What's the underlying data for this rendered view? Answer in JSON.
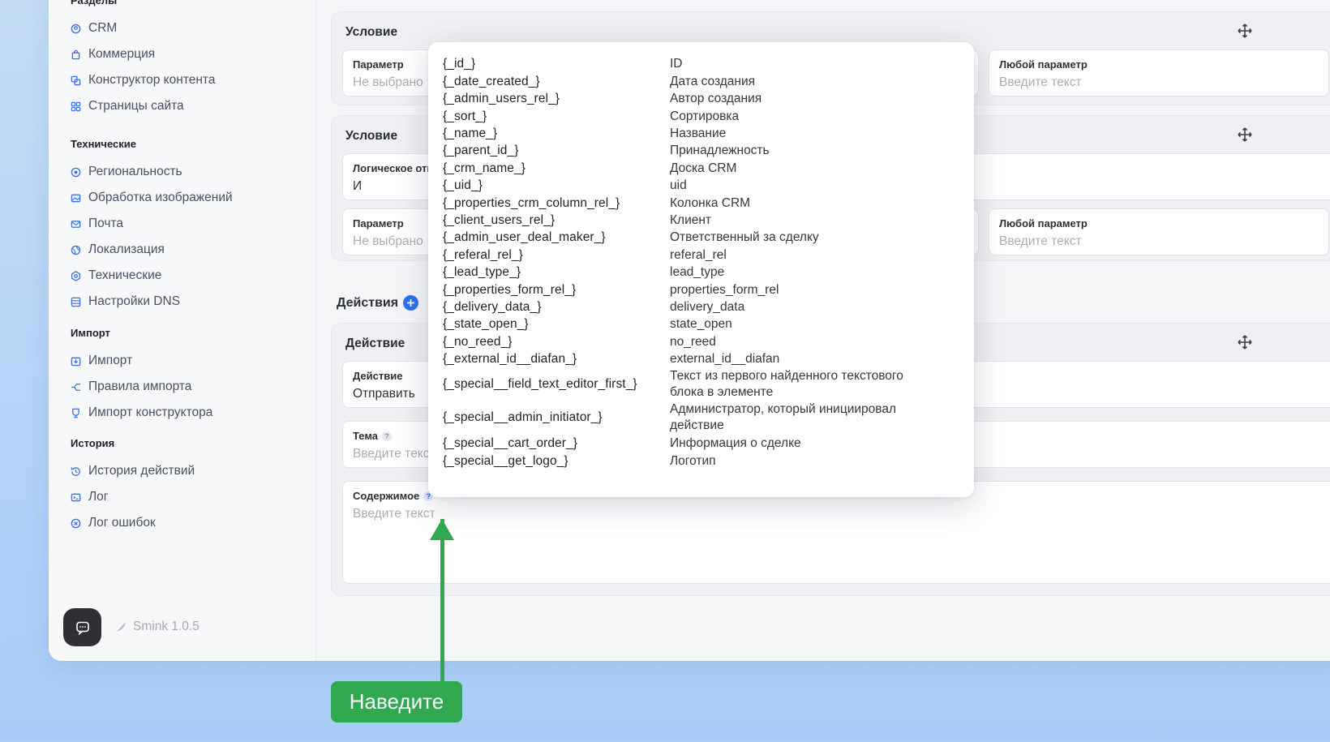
{
  "sidebar": {
    "section_title": "Разделы",
    "groups": [
      {
        "title": "",
        "items": [
          {
            "label": "CRM",
            "icon": "crm-icon"
          },
          {
            "label": "Коммерция",
            "icon": "bag-icon"
          },
          {
            "label": "Конструктор контента",
            "icon": "layers-icon"
          },
          {
            "label": "Страницы сайта",
            "icon": "grid-icon"
          }
        ]
      },
      {
        "title": "Технические",
        "items": [
          {
            "label": "Региональность",
            "icon": "location-icon"
          },
          {
            "label": "Обработка изображений",
            "icon": "image-icon"
          },
          {
            "label": "Почта",
            "icon": "mail-icon"
          },
          {
            "label": "Локализация",
            "icon": "globe-icon"
          },
          {
            "label": "Технические",
            "icon": "gear-icon"
          },
          {
            "label": "Настройки DNS",
            "icon": "server-icon"
          }
        ]
      },
      {
        "title": "Импорт",
        "items": [
          {
            "label": "Импорт",
            "icon": "import-icon"
          },
          {
            "label": "Правила импорта",
            "icon": "branch-icon"
          },
          {
            "label": "Импорт конструктора",
            "icon": "trophy-icon"
          }
        ]
      },
      {
        "title": "История",
        "items": [
          {
            "label": "История действий",
            "icon": "history-icon"
          },
          {
            "label": "Лог",
            "icon": "terminal-icon"
          },
          {
            "label": "Лог ошибок",
            "icon": "error-icon"
          }
        ]
      }
    ],
    "version": "Smink 1.0.5"
  },
  "condition1": {
    "title": "Условие",
    "param_label": "Параметр",
    "param_value": "Не выбрано",
    "any_label": "Любой параметр",
    "any_placeholder": "Введите текст"
  },
  "condition2": {
    "title": "Условие",
    "logic_label": "Логическое отношение",
    "logic_value": "И",
    "param_label": "Параметр",
    "param_value": "Не выбрано",
    "any_label": "Любой параметр",
    "any_placeholder": "Введите текст"
  },
  "actions": {
    "title": "Действия",
    "card_title": "Действие",
    "action_label": "Действие",
    "action_value": "Отправить",
    "subject_label": "Тема",
    "subject_placeholder": "Введите текст",
    "content_label": "Содержимое",
    "content_placeholder": "Введите текст"
  },
  "tooltip": {
    "rows": [
      {
        "key": "{_id_}",
        "desc": "ID"
      },
      {
        "key": "{_date_created_}",
        "desc": "Дата создания"
      },
      {
        "key": "{_admin_users_rel_}",
        "desc": "Автор создания"
      },
      {
        "key": "{_sort_}",
        "desc": "Сортировка"
      },
      {
        "key": "{_name_}",
        "desc": "Название"
      },
      {
        "key": "{_parent_id_}",
        "desc": "Принадлежность"
      },
      {
        "key": "{_crm_name_}",
        "desc": "Доска CRM"
      },
      {
        "key": "{_uid_}",
        "desc": "uid"
      },
      {
        "key": "{_properties_crm_column_rel_}",
        "desc": "Колонка CRM"
      },
      {
        "key": "{_client_users_rel_}",
        "desc": "Клиент"
      },
      {
        "key": "{_admin_user_deal_maker_}",
        "desc": "Ответственный за сделку"
      },
      {
        "key": "{_referal_rel_}",
        "desc": "referal_rel"
      },
      {
        "key": "{_lead_type_}",
        "desc": "lead_type"
      },
      {
        "key": "{_properties_form_rel_}",
        "desc": "properties_form_rel"
      },
      {
        "key": "{_delivery_data_}",
        "desc": "delivery_data"
      },
      {
        "key": "{_state_open_}",
        "desc": "state_open"
      },
      {
        "key": "{_no_reed_}",
        "desc": "no_reed"
      },
      {
        "key": "{_external_id__diafan_}",
        "desc": "external_id__diafan"
      },
      {
        "key": "{_special__field_text_editor_first_}",
        "desc": "Текст из первого найденного текстового блока в элементе"
      },
      {
        "key": "{_special__admin_initiator_}",
        "desc": "Администратор, который инициировал действие"
      },
      {
        "key": "{_special__cart_order_}",
        "desc": "Информация о сделке"
      },
      {
        "key": "{_special__get_logo_}",
        "desc": "Логотип"
      }
    ]
  },
  "hint": {
    "label": "Наведите"
  },
  "colors": {
    "accent": "#2d6ff0",
    "hint_green": "#2fa84f",
    "sidebar_icon": "#3c6fe0"
  }
}
